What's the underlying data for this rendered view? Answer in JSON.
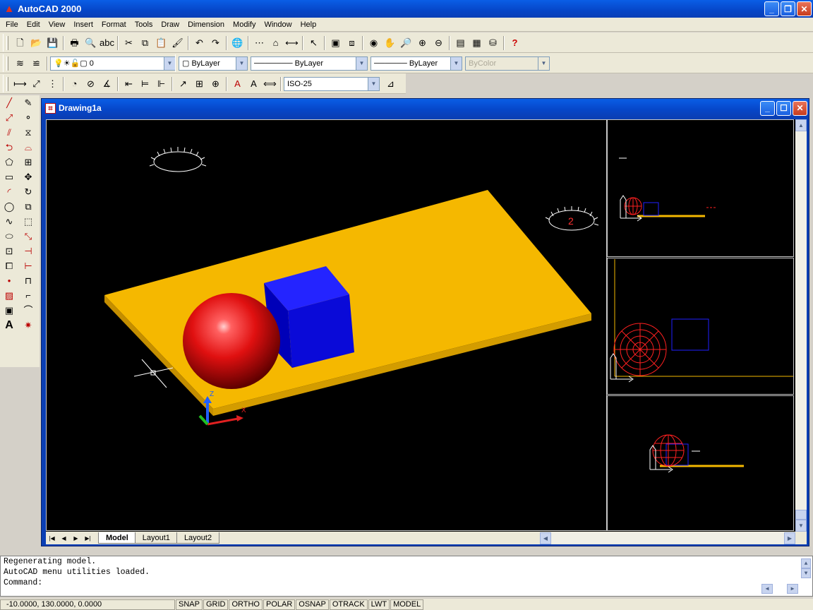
{
  "app": {
    "title": "AutoCAD 2000"
  },
  "menu": [
    "File",
    "Edit",
    "View",
    "Insert",
    "Format",
    "Tools",
    "Draw",
    "Dimension",
    "Modify",
    "Window",
    "Help"
  ],
  "toolbar2": {
    "layer": "0",
    "color": "ByLayer",
    "linetype": "ByLayer",
    "lineweight": "ByLayer",
    "plotstyle": "ByColor"
  },
  "toolbar3": {
    "dimstyle": "ISO-25"
  },
  "drawing": {
    "title": "Drawing1a"
  },
  "viewport_label": "2",
  "ucs": {
    "x": "X",
    "z": "Z"
  },
  "tabs": [
    "Model",
    "Layout1",
    "Layout2"
  ],
  "command": {
    "lines": [
      "Regenerating model.",
      "AutoCAD menu utilities loaded.",
      "Command:"
    ]
  },
  "status": {
    "coords": "-10.0000, 130.0000, 0.0000",
    "buttons": [
      "SNAP",
      "GRID",
      "ORTHO",
      "POLAR",
      "OSNAP",
      "OTRACK",
      "LWT",
      "MODEL"
    ]
  }
}
